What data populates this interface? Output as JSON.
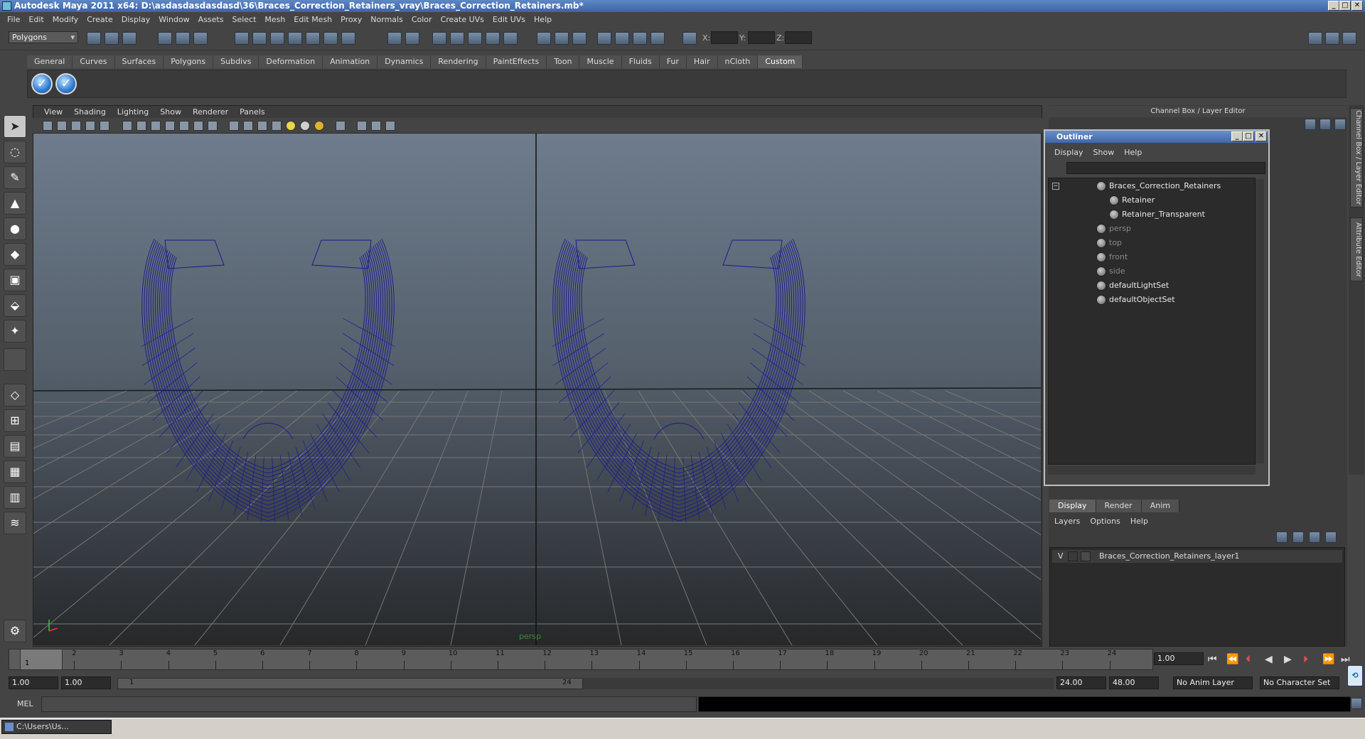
{
  "titlebar": {
    "title": "Autodesk Maya 2011 x64: D:\\asdasdasdasdasd\\36\\Braces_Correction_Retainers_vray\\Braces_Correction_Retainers.mb*"
  },
  "menu": [
    "File",
    "Edit",
    "Modify",
    "Create",
    "Display",
    "Window",
    "Assets",
    "Select",
    "Mesh",
    "Edit Mesh",
    "Proxy",
    "Normals",
    "Color",
    "Create UVs",
    "Edit UVs",
    "Help"
  ],
  "statusline": {
    "mode": "Polygons",
    "x_label": "X:",
    "y_label": "Y:",
    "z_label": "Z:"
  },
  "shelf_tabs": [
    "General",
    "Curves",
    "Surfaces",
    "Polygons",
    "Subdivs",
    "Deformation",
    "Animation",
    "Dynamics",
    "Rendering",
    "PaintEffects",
    "Toon",
    "Muscle",
    "Fluids",
    "Fur",
    "Hair",
    "nCloth",
    "Custom"
  ],
  "shelf_active": "Custom",
  "viewport": {
    "menu": [
      "View",
      "Shading",
      "Lighting",
      "Show",
      "Renderer",
      "Panels"
    ],
    "camera": "persp",
    "wire_color": "#1a1a8c"
  },
  "right_panel": {
    "title": "Channel Box / Layer Editor",
    "side_tabs": [
      "Channel Box / Layer Editor",
      "Attribute Editor"
    ]
  },
  "outliner": {
    "title": "Outliner",
    "menu": [
      "Display",
      "Show",
      "Help"
    ],
    "items": [
      {
        "label": "Braces_Correction_Retainers",
        "dim": false
      },
      {
        "label": "Retainer",
        "dim": false
      },
      {
        "label": "Retainer_Transparent",
        "dim": false
      },
      {
        "label": "persp",
        "dim": true
      },
      {
        "label": "top",
        "dim": true
      },
      {
        "label": "front",
        "dim": true
      },
      {
        "label": "side",
        "dim": true
      },
      {
        "label": "defaultLightSet",
        "dim": false
      },
      {
        "label": "defaultObjectSet",
        "dim": false
      }
    ]
  },
  "layers": {
    "tabs": [
      "Display",
      "Render",
      "Anim"
    ],
    "active_tab": "Display",
    "menu": [
      "Layers",
      "Options",
      "Help"
    ],
    "row": {
      "visible": "V",
      "name": "Braces_Correction_Retainers_layer1"
    }
  },
  "timeline": {
    "frames": [
      "1",
      "2",
      "3",
      "4",
      "5",
      "6",
      "7",
      "8",
      "9",
      "10",
      "11",
      "12",
      "13",
      "14",
      "15",
      "16",
      "17",
      "18",
      "19",
      "20",
      "21",
      "22",
      "23",
      "24"
    ],
    "current_marker": "1",
    "current_frame": "1.00"
  },
  "range": {
    "start": "1.00",
    "playback_start": "1.00",
    "slider_start": "1",
    "slider_end": "24",
    "playback_end": "24.00",
    "end": "48.00",
    "anim_layer": "No Anim Layer",
    "character_set": "No Character Set"
  },
  "cmdline": {
    "label": "MEL"
  },
  "taskbar": {
    "item": "C:\\Users\\Us..."
  }
}
